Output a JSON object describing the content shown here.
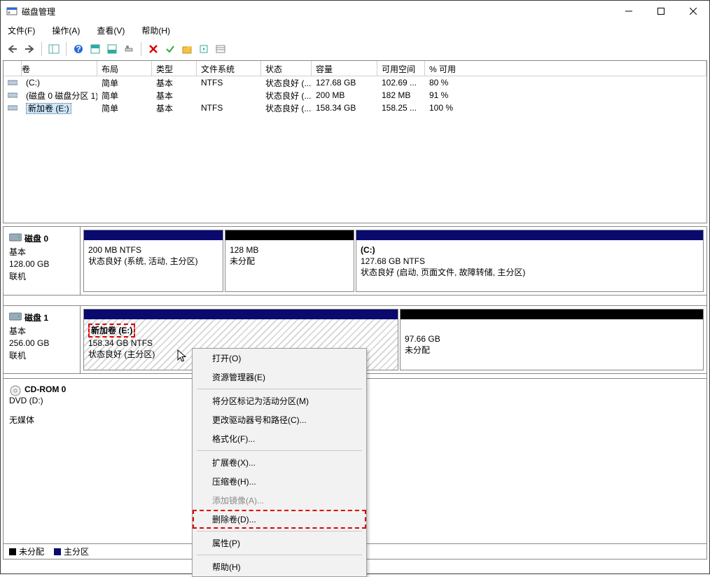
{
  "title": "磁盘管理",
  "menu": [
    "文件(F)",
    "操作(A)",
    "查看(V)",
    "帮助(H)"
  ],
  "columns": {
    "vol": "卷",
    "lay": "布局",
    "typ": "类型",
    "fs": "文件系统",
    "st": "状态",
    "cap": "容量",
    "free": "可用空间",
    "pct": "% 可用"
  },
  "rows": [
    {
      "icon": "vol",
      "name": "(C:)",
      "lay": "简单",
      "typ": "基本",
      "fs": "NTFS",
      "st": "状态良好 (...",
      "cap": "127.68 GB",
      "free": "102.69 ...",
      "pct": "80 %"
    },
    {
      "icon": "vol",
      "name": "(磁盘 0 磁盘分区 1)",
      "lay": "简单",
      "typ": "基本",
      "fs": "",
      "st": "状态良好 (...",
      "cap": "200 MB",
      "free": "182 MB",
      "pct": "91 %"
    },
    {
      "icon": "vol",
      "name": "新加卷 (E:)",
      "lay": "简单",
      "typ": "基本",
      "fs": "NTFS",
      "st": "状态良好 (...",
      "cap": "158.34 GB",
      "free": "158.25 ...",
      "pct": "100 %",
      "selected": true
    }
  ],
  "disks": {
    "d0": {
      "name": "磁盘 0",
      "type": "基本",
      "size": "128.00 GB",
      "status": "联机",
      "p0": {
        "line1": "",
        "line2": "200 MB NTFS",
        "line3": "状态良好 (系统, 活动, 主分区)"
      },
      "p1": {
        "line1": "",
        "line2": "128 MB",
        "line3": "未分配"
      },
      "p2": {
        "line1": "(C:)",
        "line2": "127.68 GB NTFS",
        "line3": "状态良好 (启动, 页面文件, 故障转储, 主分区)"
      }
    },
    "d1": {
      "name": "磁盘 1",
      "type": "基本",
      "size": "256.00 GB",
      "status": "联机",
      "p0": {
        "line1": "新加卷  (E:)",
        "line2": "158.34 GB NTFS",
        "line3": "状态良好 (主分区)"
      },
      "p1": {
        "line1": "",
        "line2": "97.66 GB",
        "line3": "未分配"
      }
    },
    "cd": {
      "name": "CD-ROM 0",
      "type": "DVD (D:)",
      "status": "无媒体"
    }
  },
  "legend": {
    "unalloc": "未分配",
    "primary": "主分区"
  },
  "context": {
    "open": "打开(O)",
    "explorer": "资源管理器(E)",
    "markActive": "将分区标记为活动分区(M)",
    "changeLetter": "更改驱动器号和路径(C)...",
    "format": "格式化(F)...",
    "extend": "扩展卷(X)...",
    "shrink": "压缩卷(H)...",
    "mirror": "添加镜像(A)...",
    "delete": "删除卷(D)...",
    "properties": "属性(P)",
    "help": "帮助(H)"
  }
}
